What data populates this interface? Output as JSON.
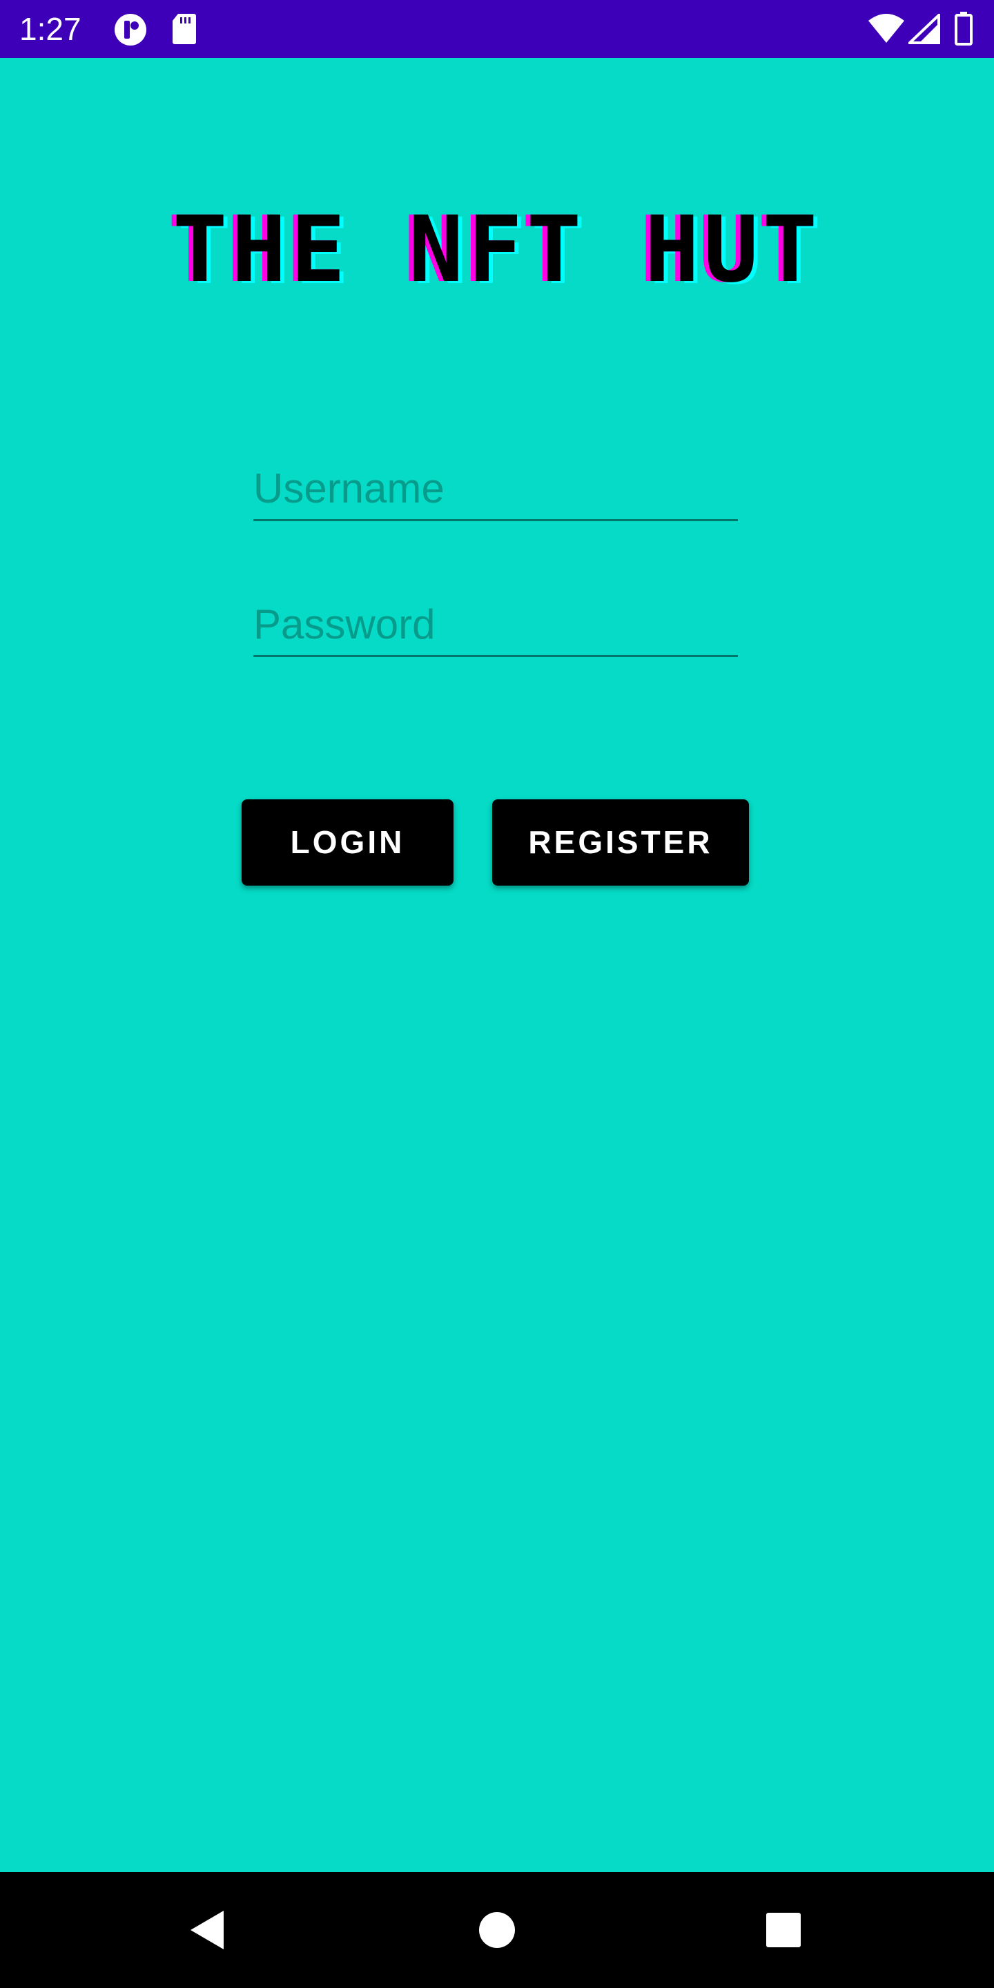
{
  "status_bar": {
    "time": "1:27",
    "icons": [
      "app-notification-icon",
      "sd-card-icon",
      "wifi-icon",
      "cell-signal-icon",
      "battery-icon"
    ]
  },
  "app": {
    "title": "THE NFT HUT"
  },
  "login_form": {
    "username_placeholder": "Username",
    "username_value": "",
    "password_placeholder": "Password",
    "password_value": "",
    "login_label": "LOGIN",
    "register_label": "REGISTER"
  },
  "nav_bar": {
    "icons": [
      "back-icon",
      "home-icon",
      "recents-icon"
    ]
  },
  "colors": {
    "background": "#05dbc6",
    "status_bar": "#3d00b8",
    "button": "#000000",
    "title_shadow_magenta": "#ff00e6",
    "title_shadow_cyan": "#00ffff",
    "field_underline": "#00776b",
    "placeholder": "#079b8c"
  }
}
